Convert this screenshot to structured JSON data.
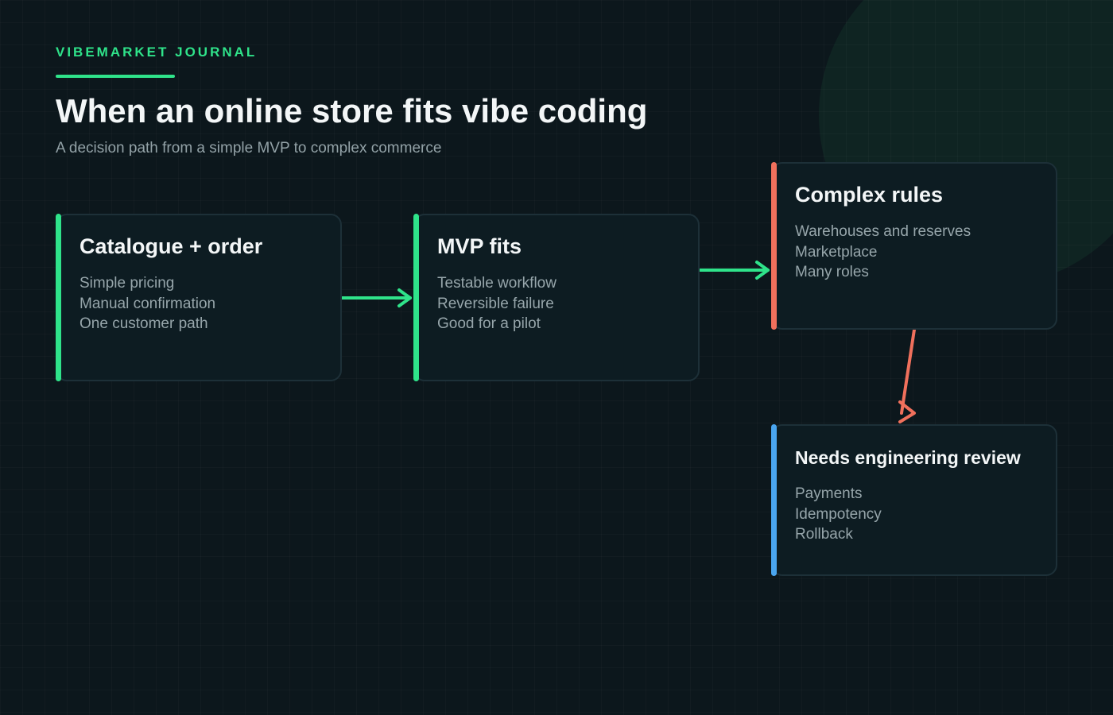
{
  "header": {
    "kicker": "VIBEMARKET JOURNAL",
    "title": "When an online store fits vibe coding",
    "subtitle": "A decision path from a simple MVP to complex commerce"
  },
  "colors": {
    "background": "#0c171c",
    "green": "#2fe38a",
    "coral": "#f0705c",
    "blue": "#4aa6f0"
  },
  "cards": [
    {
      "title": "Catalogue + order",
      "items": [
        "Simple pricing",
        "Manual confirmation",
        "One customer path"
      ],
      "accent": "#2fe38a"
    },
    {
      "title": "MVP fits",
      "items": [
        "Testable workflow",
        "Reversible failure",
        "Good for a pilot"
      ],
      "accent": "#2fe38a"
    },
    {
      "title": "Complex rules",
      "items": [
        "Warehouses and reserves",
        "Marketplace",
        "Many roles"
      ],
      "accent": "#f0705c"
    },
    {
      "title": "Needs engineering review",
      "items": [
        "Payments",
        "Idempotency",
        "Rollback"
      ],
      "accent": "#4aa6f0"
    }
  ],
  "connectors": [
    {
      "from": "Catalogue + order",
      "to": "MVP fits",
      "color": "#2fe38a"
    },
    {
      "from": "MVP fits",
      "to": "Complex rules",
      "color": "#2fe38a"
    },
    {
      "from": "Complex rules",
      "to": "Needs engineering review",
      "color": "#f0705c"
    }
  ]
}
